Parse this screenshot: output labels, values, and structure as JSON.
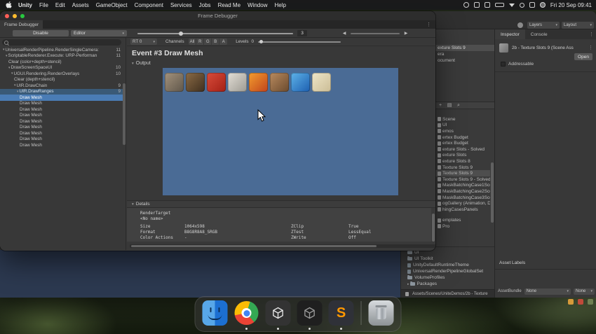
{
  "menubar": {
    "menus": [
      "Unity",
      "File",
      "Edit",
      "Assets",
      "GameObject",
      "Component",
      "Services",
      "Jobs",
      "Read Me",
      "Window",
      "Help"
    ],
    "status_icons": [
      "screen-record-icon",
      "display-icon",
      "keyboard-icon",
      "battery-icon",
      "wifi-icon",
      "spotlight-icon",
      "control-center-icon",
      "siri-icon"
    ],
    "clock": "Fri 20 Sep 09:41"
  },
  "frame_debugger": {
    "window_title": "Frame Debugger",
    "tab": "Frame Debugger",
    "toolbar": {
      "disable": "Disable",
      "editor": "Editor",
      "event_number": "3"
    },
    "view_bar": {
      "rt": "RT 0",
      "channels_label": "Channels",
      "channels": [
        "All",
        "R",
        "G",
        "B",
        "A"
      ],
      "levels_label": "Levels",
      "levels_value": "0"
    },
    "event_title": "Event #3 Draw Mesh",
    "output_label": "Output",
    "details_label": "Details",
    "tree": [
      {
        "label": "UniversalRenderPipeline.RenderSingleCamera:",
        "count": "11",
        "depth": 0,
        "fold": true,
        "state": ""
      },
      {
        "label": "ScriptableRenderer.Execute: URP-Performan",
        "count": "11",
        "depth": 1,
        "fold": true,
        "state": ""
      },
      {
        "label": "Clear (color+depth+stencil)",
        "count": "",
        "depth": 2,
        "fold": false,
        "state": ""
      },
      {
        "label": "DrawScreenSpaceUI",
        "count": "10",
        "depth": 2,
        "fold": true,
        "state": ""
      },
      {
        "label": "UGUI.Rendering.RenderOverlays",
        "count": "10",
        "depth": 3,
        "fold": true,
        "state": ""
      },
      {
        "label": "Clear (depth+stencil)",
        "count": "",
        "depth": 4,
        "fold": false,
        "state": ""
      },
      {
        "label": "UIR.DrawChain",
        "count": "9",
        "depth": 4,
        "fold": true,
        "state": ""
      },
      {
        "label": "UIR.DrawRanges",
        "count": "9",
        "depth": 5,
        "fold": true,
        "state": "context"
      },
      {
        "label": "Draw Mesh",
        "count": "",
        "depth": 6,
        "fold": false,
        "state": "selected"
      },
      {
        "label": "Draw Mesh",
        "count": "",
        "depth": 6,
        "fold": false,
        "state": ""
      },
      {
        "label": "Draw Mesh",
        "count": "",
        "depth": 6,
        "fold": false,
        "state": ""
      },
      {
        "label": "Draw Mesh",
        "count": "",
        "depth": 6,
        "fold": false,
        "state": ""
      },
      {
        "label": "Draw Mesh",
        "count": "",
        "depth": 6,
        "fold": false,
        "state": ""
      },
      {
        "label": "Draw Mesh",
        "count": "",
        "depth": 6,
        "fold": false,
        "state": ""
      },
      {
        "label": "Draw Mesh",
        "count": "",
        "depth": 6,
        "fold": false,
        "state": ""
      },
      {
        "label": "Draw Mesh",
        "count": "",
        "depth": 6,
        "fold": false,
        "state": ""
      },
      {
        "label": "Draw Mesh",
        "count": "",
        "depth": 6,
        "fold": false,
        "state": ""
      }
    ],
    "details": {
      "target_label": "RenderTarget",
      "target_name": "<No name>",
      "rows": [
        [
          "Size",
          "1064x598",
          "ZClip",
          "True"
        ],
        [
          "Format",
          "B8G8R8A8_SRGB",
          "ZTest",
          "LessEqual"
        ],
        [
          "Color Actions",
          "-",
          "ZWrite",
          "Off"
        ]
      ]
    },
    "thumbnails": [
      {
        "name": "rock-texture-thumb",
        "g1": "#a3927c",
        "g2": "#5f564a"
      },
      {
        "name": "character-sprite-thumb",
        "g1": "#8a6a45",
        "g2": "#3f2f1e"
      },
      {
        "name": "red-icon-thumb",
        "g1": "#d84b3a",
        "g2": "#a32015"
      },
      {
        "name": "stone-texture-thumb",
        "g1": "#e2ded6",
        "g2": "#9d9a92"
      },
      {
        "name": "lava-texture-thumb",
        "g1": "#f39c2d",
        "g2": "#c0441d"
      },
      {
        "name": "portrait-sprite-thumb",
        "g1": "#b98a5e",
        "g2": "#6a4a2e"
      },
      {
        "name": "water-texture-thumb",
        "g1": "#5db2e8",
        "g2": "#1d5fb0"
      },
      {
        "name": "tablet-texture-thumb",
        "g1": "#efe6c8",
        "g2": "#cbbd96"
      }
    ]
  },
  "editor": {
    "toolbar": {
      "layers": "Layers",
      "layout": "Layout"
    },
    "tabs": [
      "Inspector",
      "Console"
    ],
    "inspector": {
      "asset_title": "2b - Texture Slots 9 (Scene Ass",
      "open": "Open",
      "addressable": "Addressable",
      "asset_labels": "Asset Labels",
      "assetbundle": "AssetBundle",
      "bundle_value": "None",
      "variant_value": "None"
    },
    "hierarchy_items": [
      {
        "label": "exture Slots 9",
        "selected": true
      },
      {
        "label": "era",
        "selected": false
      },
      {
        "label": "ocument",
        "selected": false
      }
    ],
    "project_items": [
      {
        "label": "Scene"
      },
      {
        "label": "UI"
      },
      {
        "label": "emos"
      },
      {
        "label": "ertex Budget"
      },
      {
        "label": "ertex Budget"
      },
      {
        "label": "exture Slots - Solved"
      },
      {
        "label": "exture Slots"
      },
      {
        "label": "exture Slots 8"
      },
      {
        "label": "Texture Slots 9"
      },
      {
        "label": "Texture Slots 9",
        "selected": true
      },
      {
        "label": "Texture Slots 9 - Solved"
      },
      {
        "label": "MaskBatchingCase1Scen"
      },
      {
        "label": "MaskBatchingCase2Sce"
      },
      {
        "label": "MaskBatchingCase3Sce"
      },
      {
        "label": "ogGallery (Animation, D"
      },
      {
        "label": "hingCasesPanels"
      },
      {
        "label": "emplates",
        "gap": true
      },
      {
        "label": "Pro"
      }
    ],
    "folder_items": [
      {
        "label": "UI",
        "icon": "folder"
      },
      {
        "label": "UI Toolkit",
        "icon": "folder"
      },
      {
        "label": "UnityDefaultRuntimeTheme",
        "icon": "asset"
      },
      {
        "label": "UniversalRenderPipelineGlobalSet",
        "icon": "asset"
      },
      {
        "label": "VolumeProfiles",
        "icon": "folder"
      },
      {
        "label": "Packages",
        "icon": "folder",
        "arrow": true
      }
    ],
    "path_bar": "Assets/Scenes/UniteDemos/2b - Texture"
  },
  "dock": {
    "items": [
      {
        "name": "finder-dock-icon",
        "running": false
      },
      {
        "name": "chrome-dock-icon",
        "running": true
      },
      {
        "name": "unity-hub-dock-icon",
        "running": true
      },
      {
        "name": "unity-editor-dock-icon",
        "running": true
      },
      {
        "name": "sublime-text-dock-icon",
        "running": true,
        "glyph": "S"
      },
      {
        "name": "trash-dock-icon",
        "running": false
      }
    ]
  }
}
